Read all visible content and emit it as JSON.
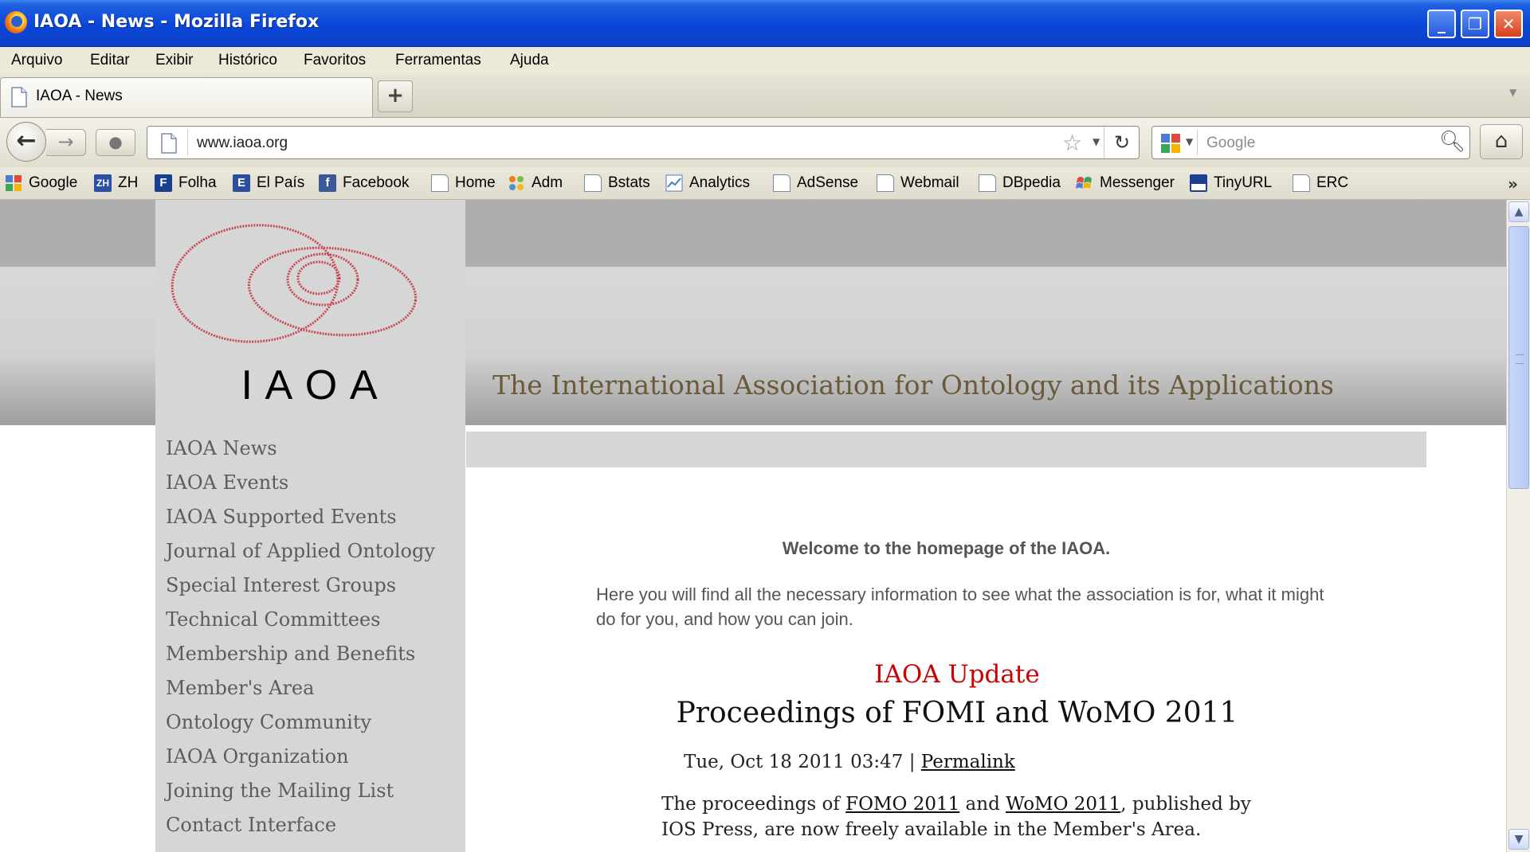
{
  "window": {
    "title": "IAOA - News - Mozilla Firefox",
    "minimize": "_",
    "maximize": "❐",
    "close": "✕"
  },
  "menu": [
    "Arquivo",
    "Editar",
    "Exibir",
    "Histórico",
    "Favoritos",
    "Ferramentas",
    "Ajuda"
  ],
  "tabs": {
    "active_label": "IAOA - News",
    "new_tab": "+"
  },
  "nav": {
    "url": "www.iaoa.org",
    "search_placeholder": "Google",
    "icons": [
      "back-icon",
      "forward-icon",
      "identity-icon",
      "star-icon",
      "reload-icon",
      "search-icon",
      "home-icon"
    ]
  },
  "bookmarks": [
    {
      "label": "Google",
      "icon": "google-icon",
      "color": "#3a76d6"
    },
    {
      "label": "ZH",
      "icon": "zh-icon",
      "color": "#2b4fa5"
    },
    {
      "label": "Folha",
      "icon": "folha-icon",
      "color": "#1a3f8f"
    },
    {
      "label": "El País",
      "icon": "elpais-icon",
      "color": "#2a4f9f"
    },
    {
      "label": "Facebook",
      "icon": "facebook-icon",
      "color": "#3b5998"
    },
    {
      "label": "Home",
      "icon": "page-icon",
      "color": "#ffffff"
    },
    {
      "label": "Adm",
      "icon": "joomla-icon",
      "color": "#f07c1a"
    },
    {
      "label": "Bstats",
      "icon": "page-icon",
      "color": "#ffffff"
    },
    {
      "label": "Analytics",
      "icon": "analytics-icon",
      "color": "#4a7cc9"
    },
    {
      "label": "AdSense",
      "icon": "page-icon",
      "color": "#ffffff"
    },
    {
      "label": "Webmail",
      "icon": "page-icon",
      "color": "#ffffff"
    },
    {
      "label": "DBpedia",
      "icon": "page-icon",
      "color": "#ffffff"
    },
    {
      "label": "Messenger",
      "icon": "msn-icon",
      "color": "#e8a020"
    },
    {
      "label": "TinyURL",
      "icon": "tinyurl-icon",
      "color": "#1e3f91"
    },
    {
      "label": "ERC",
      "icon": "page-icon",
      "color": "#ffffff"
    }
  ],
  "bookmark_icon_text": {
    "zh": "ZH",
    "folha": "F",
    "elpais": "E",
    "facebook": "f"
  },
  "more_bookmarks": "»",
  "site": {
    "logo_letters": "I A O A",
    "tagline": "The International Association for Ontology and its Applications",
    "sidebar": [
      "IAOA News",
      "IAOA Events",
      "IAOA Supported Events",
      "Journal of Applied Ontology",
      "Special Interest Groups",
      "Technical Committees",
      "Membership and Benefits",
      "Member's Area",
      "Ontology Community",
      "IAOA Organization",
      "Joining the Mailing List",
      "Contact Interface"
    ],
    "welcome": "Welcome to the homepage of the IAOA.",
    "intro": "Here you will find all the necessary information to see what the association is for, what it might do for you, and how you can join.",
    "update_label": "IAOA Update",
    "headline": "Proceedings of FOMI and WoMO 2011",
    "date": "Tue, Oct 18 2011 03:47 |",
    "permalink": "Permalink",
    "body_pre": "The proceedings of",
    "link_fomo": "FOMO 2011",
    "body_mid": "and",
    "link_womo": "WoMO 2011",
    "body_post": ", published by IOS Press, are now freely available in the Member's Area.",
    "colors": {
      "logo_ring": "#c84650",
      "update": "#cc0000",
      "tagline": "#6b5a3a"
    }
  }
}
